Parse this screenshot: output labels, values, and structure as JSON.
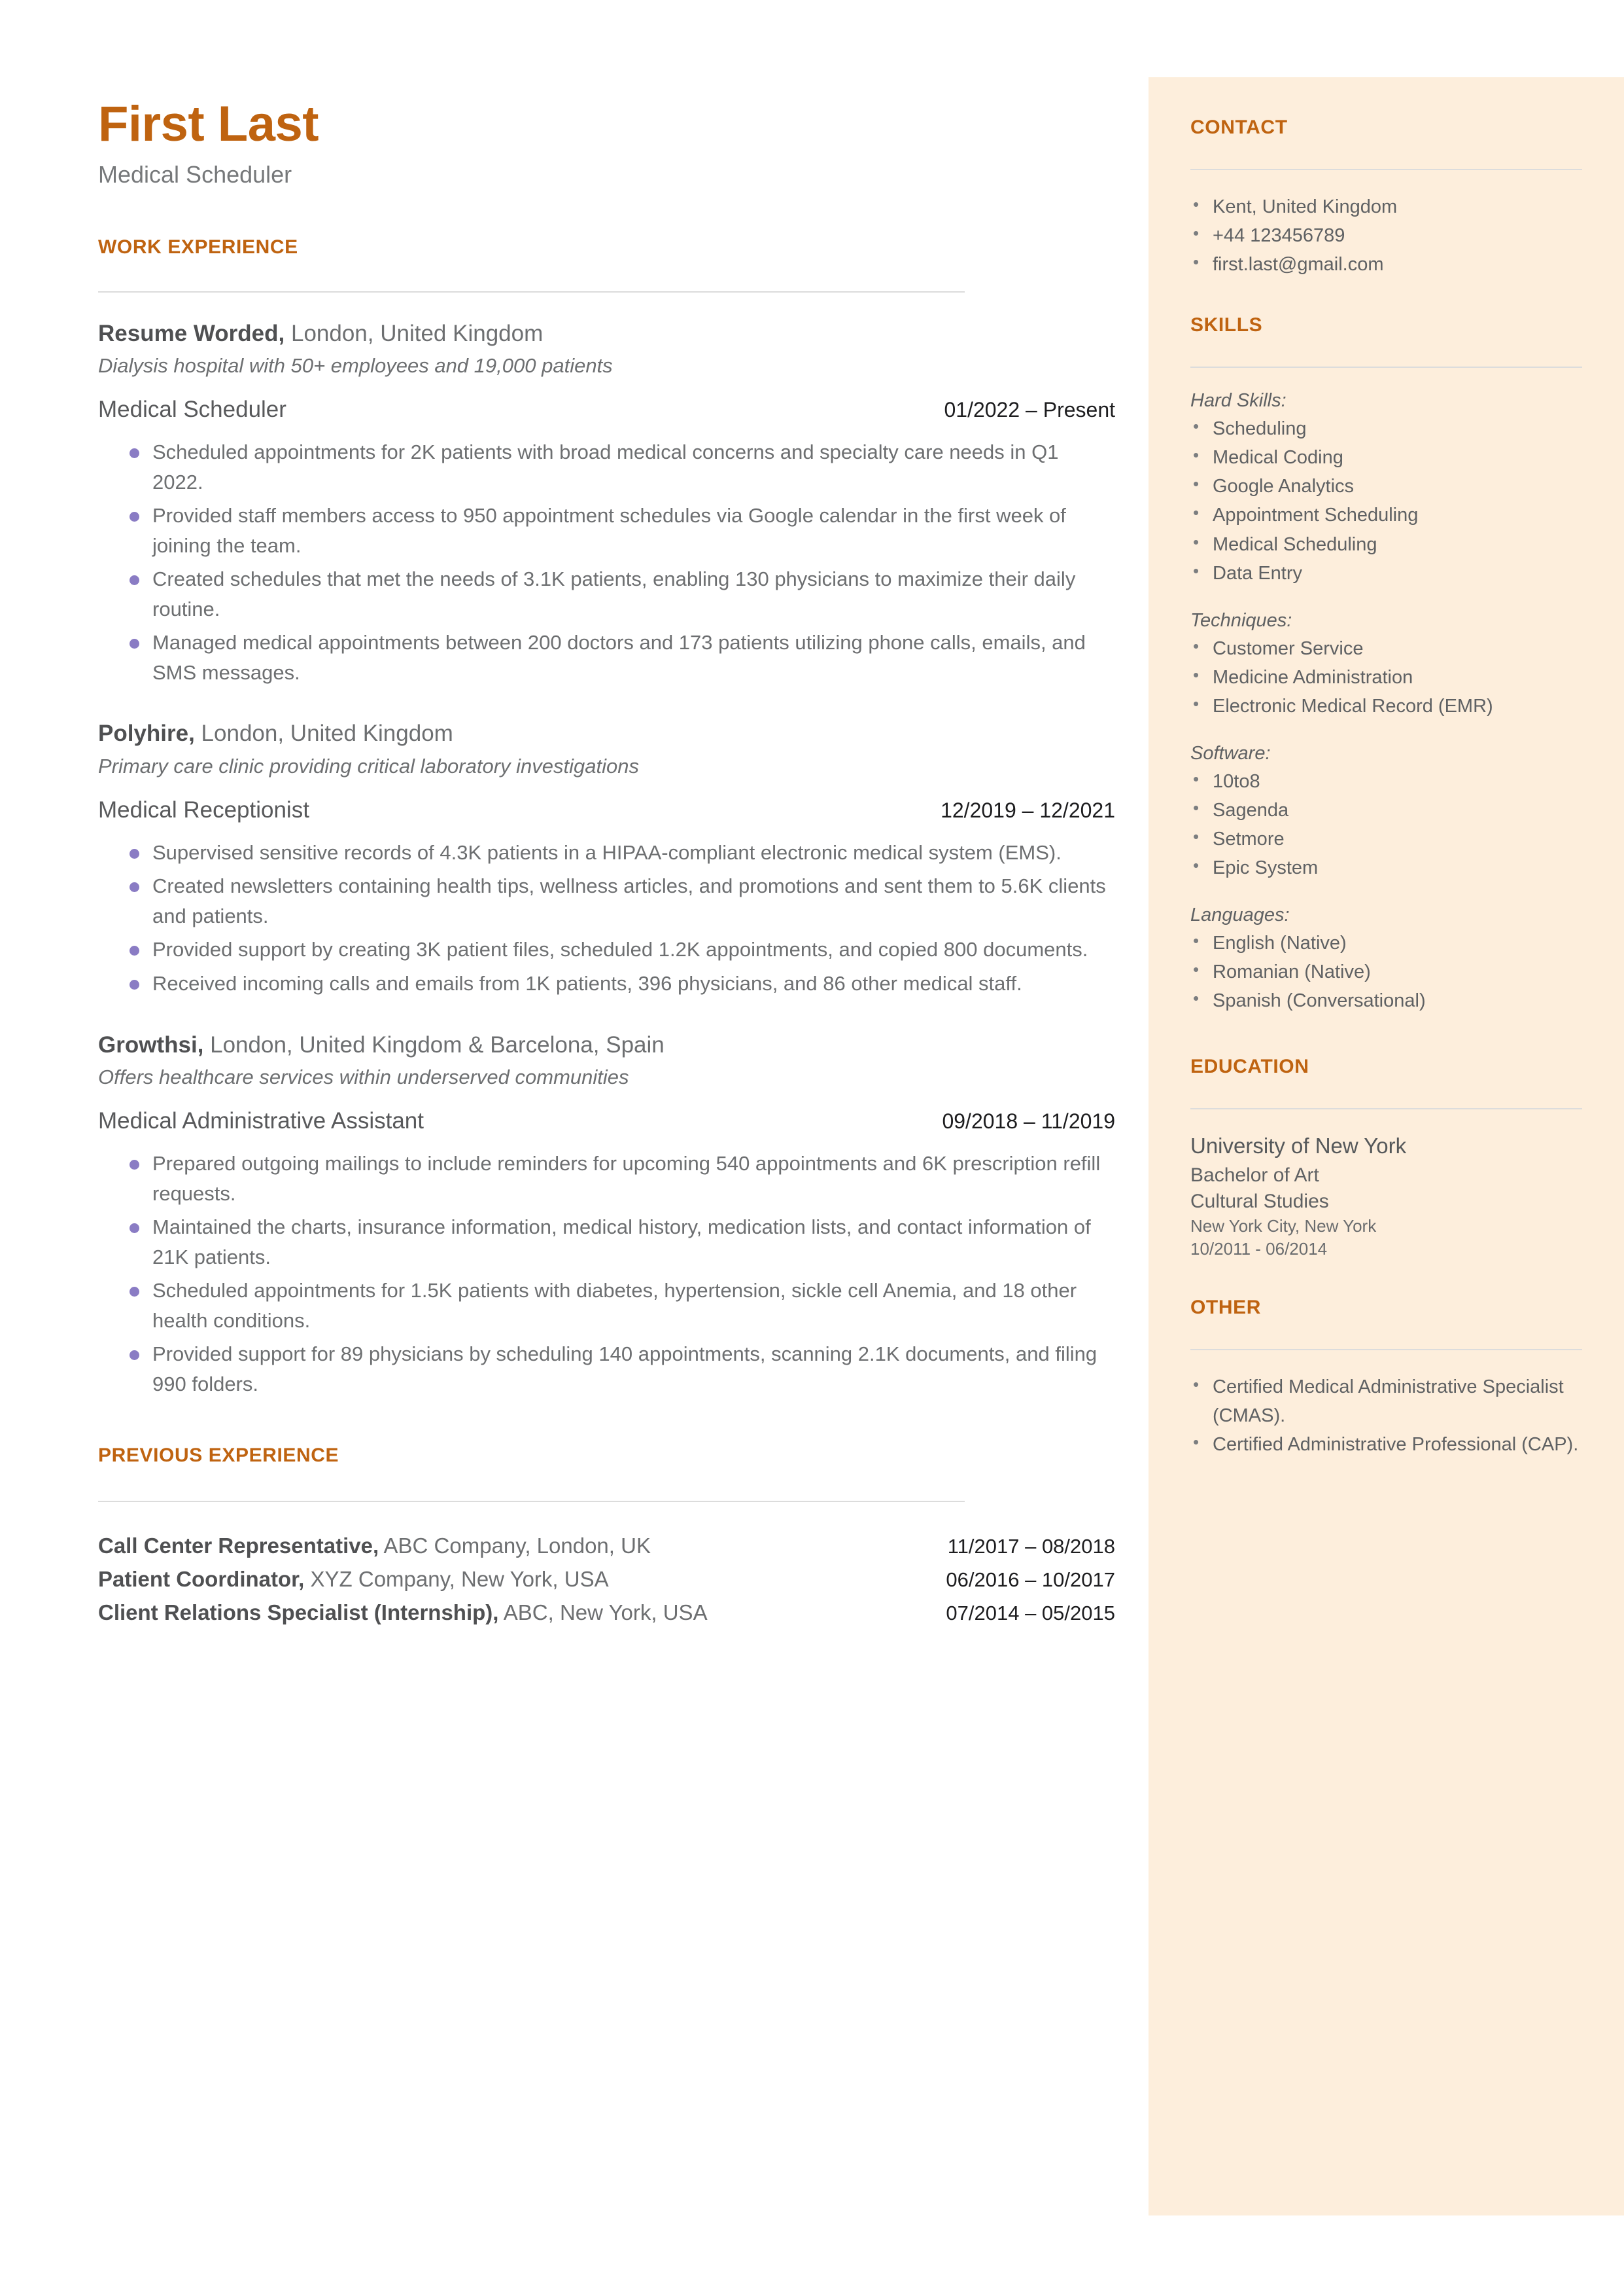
{
  "colors": {
    "accent": "#bf6310",
    "sidebar_bg": "#fdeedc",
    "bullet": "#8a7cc4",
    "body_text": "#6d6f71",
    "rule": "#dcdcdc"
  },
  "header": {
    "name": "First Last",
    "title": "Medical Scheduler"
  },
  "main": {
    "work_heading": "WORK EXPERIENCE",
    "previous_heading": "PREVIOUS EXPERIENCE",
    "jobs": [
      {
        "company": "Resume Worded,",
        "location": " London, United Kingdom",
        "description": "Dialysis hospital with 50+ employees and 19,000 patients",
        "role": "Medical Scheduler",
        "dates": "01/2022 – Present",
        "bullets": [
          "Scheduled appointments for 2K patients with broad medical concerns and specialty care needs in Q1 2022.",
          "Provided staff members access to 950 appointment schedules via Google calendar in the first week of joining the team.",
          "Created schedules that met the needs of 3.1K patients, enabling 130 physicians to maximize their daily routine.",
          "Managed medical appointments between 200 doctors and 173 patients utilizing phone calls, emails, and SMS messages."
        ]
      },
      {
        "company": "Polyhire,",
        "location": " London, United Kingdom",
        "description": "Primary care clinic providing critical laboratory investigations",
        "role": "Medical Receptionist",
        "dates": "12/2019 – 12/2021",
        "bullets": [
          "Supervised sensitive records of 4.3K patients in a HIPAA-compliant electronic medical system (EMS).",
          "Created newsletters containing health tips, wellness articles, and promotions and sent them to 5.6K clients and patients.",
          "Provided support by creating 3K patient files, scheduled 1.2K appointments, and copied 800 documents.",
          "Received incoming calls and emails from 1K patients, 396 physicians, and 86 other medical staff."
        ]
      },
      {
        "company": "Growthsi,",
        "location": " London, United Kingdom & Barcelona, Spain",
        "description": "Offers healthcare services within underserved communities",
        "role": "Medical Administrative Assistant",
        "dates": "09/2018 – 11/2019",
        "bullets": [
          "Prepared outgoing mailings to include reminders for upcoming 540 appointments and 6K prescription refill requests.",
          "Maintained the charts, insurance information, medical history, medication lists, and contact information of 21K patients.",
          "Scheduled appointments for 1.5K patients with diabetes, hypertension, sickle cell Anemia, and 18 other health conditions.",
          "Provided support for 89 physicians by scheduling 140 appointments, scanning 2.1K documents, and filing 990 folders."
        ]
      }
    ],
    "previous_jobs": [
      {
        "title": "Call Center Representative,",
        "detail": " ABC Company, London, UK",
        "dates": "11/2017 – 08/2018"
      },
      {
        "title": "Patient Coordinator,",
        "detail": " XYZ Company, New York, USA",
        "dates": "06/2016 – 10/2017"
      },
      {
        "title": "Client Relations Specialist (Internship),",
        "detail": " ABC, New York, USA",
        "dates": "07/2014 – 05/2015"
      }
    ]
  },
  "sidebar": {
    "contact": {
      "heading": "CONTACT",
      "items": [
        " Kent, United Kingdom",
        "+44 123456789",
        "first.last@gmail.com"
      ]
    },
    "skills": {
      "heading": "SKILLS",
      "groups": [
        {
          "label": "Hard Skills:",
          "items": [
            "Scheduling",
            "Medical Coding",
            "Google Analytics",
            "Appointment Scheduling",
            "Medical Scheduling",
            "Data Entry"
          ]
        },
        {
          "label": "Techniques:",
          "items": [
            "Customer Service",
            "Medicine Administration",
            "Electronic Medical Record (EMR)"
          ]
        },
        {
          "label": "Software:",
          "items": [
            "10to8",
            "Sagenda",
            "Setmore",
            "Epic System"
          ]
        },
        {
          "label": "Languages:",
          "items": [
            "English (Native)",
            "Romanian (Native)",
            "Spanish (Conversational)"
          ]
        }
      ]
    },
    "education": {
      "heading": "EDUCATION",
      "school": "University of New York",
      "degree": "Bachelor of Art",
      "field": "Cultural Studies",
      "location": "New York City, New York",
      "dates": "10/2011 - 06/2014"
    },
    "other": {
      "heading": "OTHER",
      "items": [
        "Certified Medical Administrative Specialist (CMAS).",
        "Certified Administrative Professional (CAP)."
      ]
    }
  }
}
